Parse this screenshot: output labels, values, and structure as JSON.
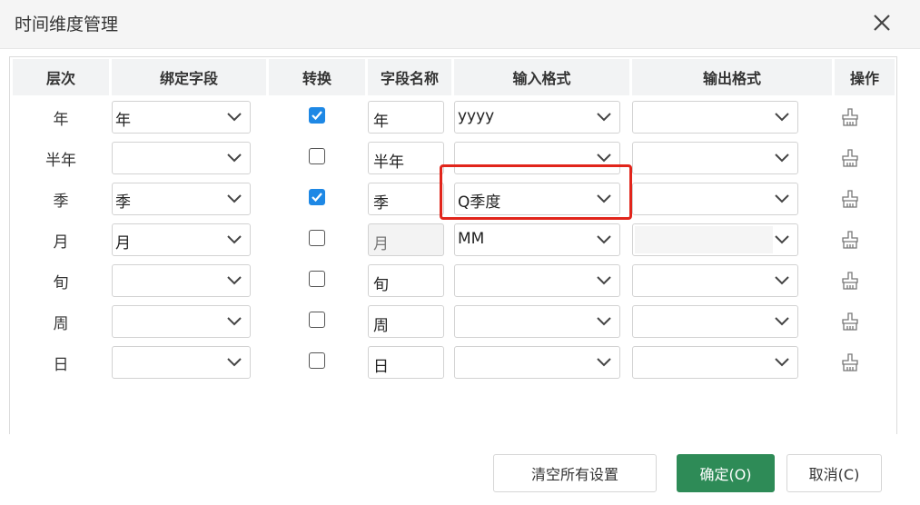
{
  "dialog": {
    "title": "时间维度管理"
  },
  "columns": {
    "level": "层次",
    "bind_field": "绑定字段",
    "convert": "转换",
    "field_name": "字段名称",
    "input_format": "输入格式",
    "output_format": "输出格式",
    "action": "操作"
  },
  "rows": [
    {
      "level": "年",
      "bind_field": "年",
      "convert": true,
      "field_name": "年",
      "field_name_editable": true,
      "input_format": "yyyy",
      "output_format": ""
    },
    {
      "level": "半年",
      "bind_field": "",
      "convert": false,
      "field_name": "半年",
      "field_name_editable": true,
      "input_format": "",
      "output_format": ""
    },
    {
      "level": "季",
      "bind_field": "季",
      "convert": true,
      "field_name": "季",
      "field_name_editable": true,
      "input_format": "Q季度",
      "output_format": ""
    },
    {
      "level": "月",
      "bind_field": "月",
      "convert": false,
      "field_name": "月",
      "field_name_editable": false,
      "input_format": "MM",
      "output_format": ""
    },
    {
      "level": "旬",
      "bind_field": "",
      "convert": false,
      "field_name": "旬",
      "field_name_editable": true,
      "input_format": "",
      "output_format": ""
    },
    {
      "level": "周",
      "bind_field": "",
      "convert": false,
      "field_name": "周",
      "field_name_editable": true,
      "input_format": "",
      "output_format": ""
    },
    {
      "level": "日",
      "bind_field": "",
      "convert": false,
      "field_name": "日",
      "field_name_editable": true,
      "input_format": "",
      "output_format": ""
    }
  ],
  "footer": {
    "clear_label": "清空所有设置",
    "ok_label": "确定(O)",
    "cancel_label": "取消(C)"
  },
  "colors": {
    "primary": "#2e8b57",
    "checkbox_on": "#1e88e5",
    "highlight": "#e1251b"
  },
  "icons": {
    "close": "close-icon",
    "dropdown": "chevron-down-icon",
    "action": "clear-brush-icon"
  }
}
